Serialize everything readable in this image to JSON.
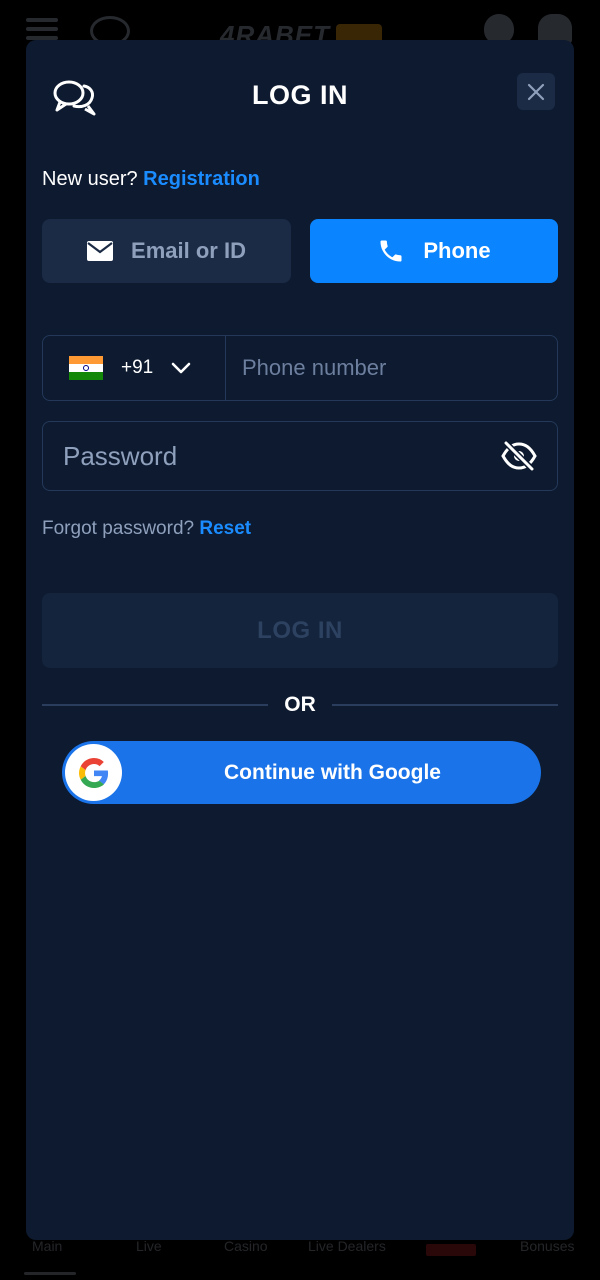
{
  "background": {
    "logo_text": "4RABET",
    "nav": [
      {
        "label": "Main"
      },
      {
        "label": "Live"
      },
      {
        "label": "Casino"
      },
      {
        "label": "Live Dealers"
      },
      {
        "label": "Bonuses"
      }
    ]
  },
  "modal": {
    "title": "LOG IN",
    "new_user_text": "New user?",
    "registration_link": "Registration",
    "tabs": {
      "email": "Email or ID",
      "phone": "Phone",
      "active": "phone"
    },
    "phone": {
      "country_code": "+91",
      "country_flag": "india-flag",
      "placeholder": "Phone number",
      "value": ""
    },
    "password": {
      "placeholder": "Password",
      "value": ""
    },
    "forgot_text": "Forgot password?",
    "reset_link": "Reset",
    "login_button": "LOG IN",
    "or_text": "OR",
    "google_button": "Continue with Google"
  },
  "colors": {
    "modal_bg": "#0d1a2f",
    "accent": "#0a84ff",
    "link": "#1a8cff",
    "google_blue": "#1a73e8",
    "disabled_button": "#14243d"
  },
  "icons": {
    "chat": "chat-icon",
    "close": "close-icon",
    "email": "mail-icon",
    "phone": "phone-icon",
    "dropdown": "chevron-down-icon",
    "password_toggle": "eye-off-icon",
    "google": "google-icon"
  }
}
